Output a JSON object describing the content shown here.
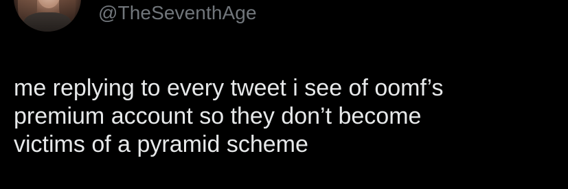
{
  "tweet": {
    "author": {
      "handle": "@TheSeventhAge",
      "avatar_icon": "user-avatar-photo"
    },
    "text_lines": [
      "me replying to every tweet i see of oomf’s",
      "premium account so they don’t become",
      "victims of a pyramid scheme"
    ]
  },
  "colors": {
    "background": "#000000",
    "handle": "#71767b",
    "text": "#e7e9ea"
  }
}
